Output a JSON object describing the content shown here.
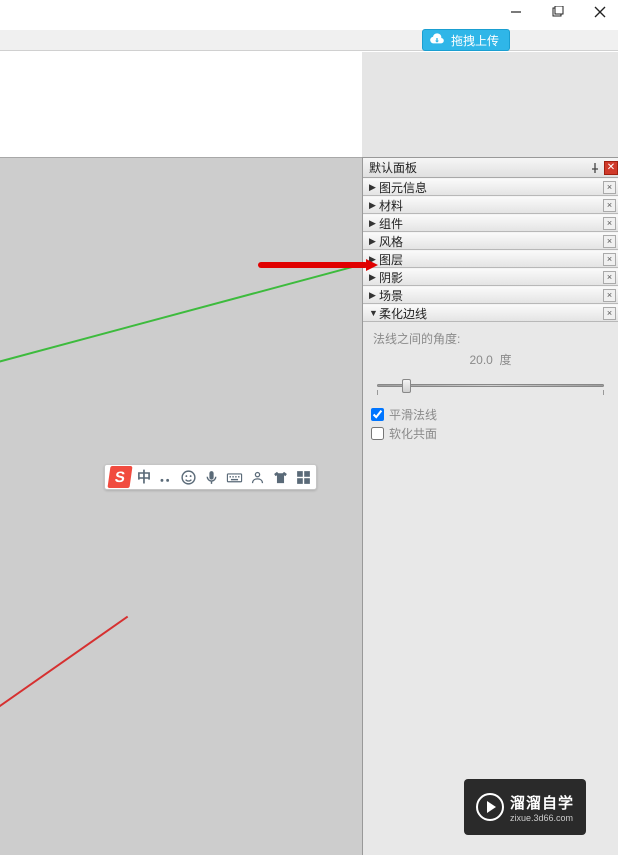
{
  "window": {
    "minimize_title": "minimize",
    "maximize_title": "maximize",
    "close_title": "close"
  },
  "upload": {
    "label": "拖拽上传"
  },
  "ime": {
    "logo": "S",
    "lang": "中"
  },
  "panel": {
    "title": "默认面板",
    "sections": [
      {
        "label": "图元信息",
        "expanded": false
      },
      {
        "label": "材料",
        "expanded": false
      },
      {
        "label": "组件",
        "expanded": false
      },
      {
        "label": "风格",
        "expanded": false
      },
      {
        "label": "图层",
        "expanded": false
      },
      {
        "label": "阴影",
        "expanded": false
      },
      {
        "label": "场景",
        "expanded": false
      },
      {
        "label": "柔化边线",
        "expanded": true
      }
    ],
    "soften": {
      "angle_label": "法线之间的角度:",
      "angle_value": "20.0",
      "angle_unit": "度",
      "smooth_normals": "平滑法线",
      "smooth_normals_checked": true,
      "soften_coplanar": "软化共面",
      "soften_coplanar_checked": false
    }
  },
  "watermark": {
    "brand": "溜溜自学",
    "url": "zixue.3d66.com"
  }
}
